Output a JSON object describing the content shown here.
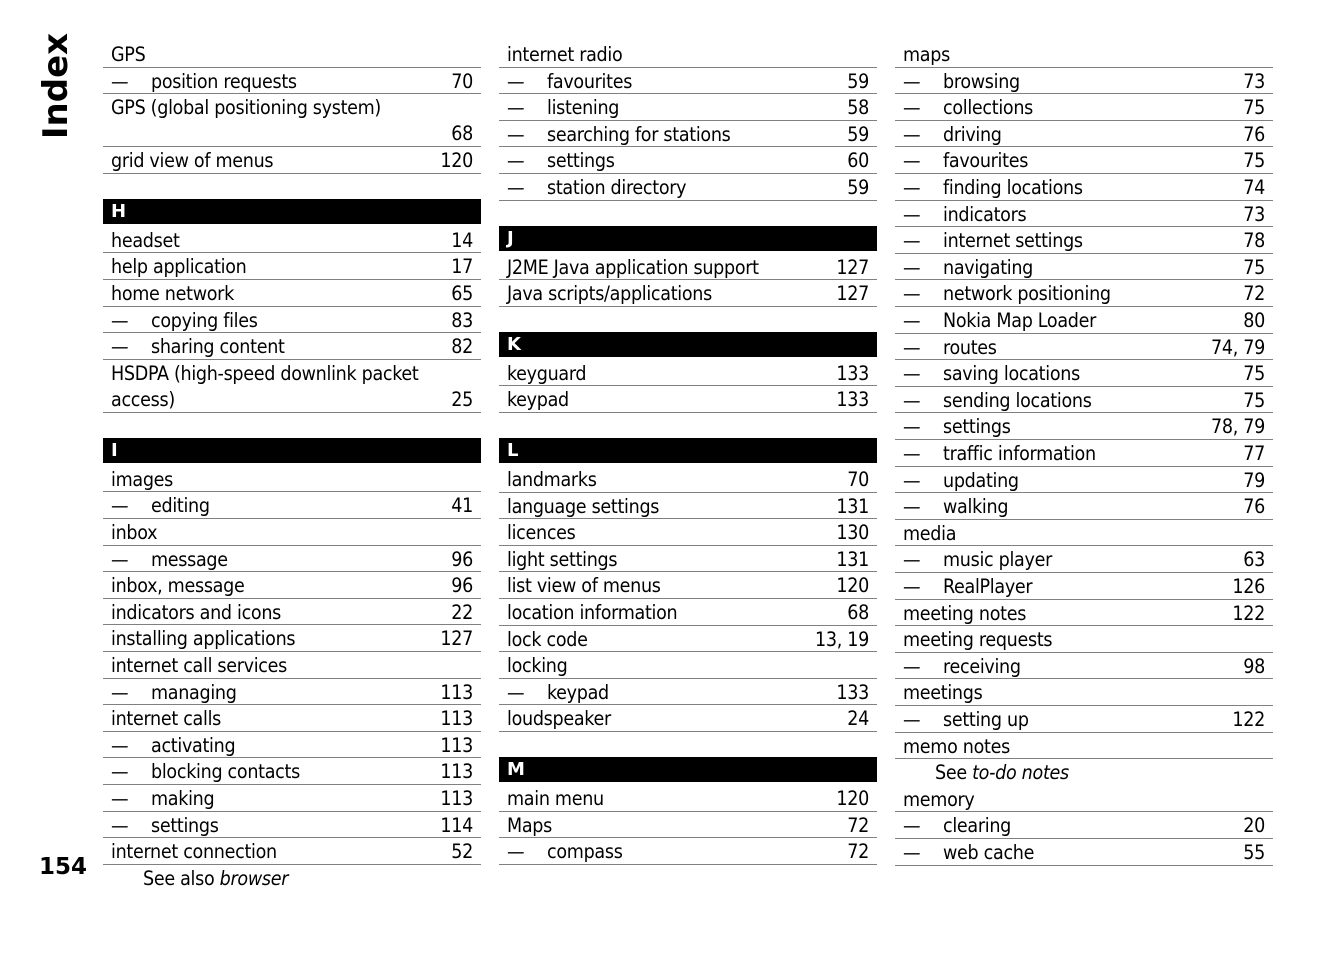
{
  "page": {
    "side_title": "Index",
    "page_number": "154"
  },
  "columns": [
    {
      "blocks": [
        {
          "type": "entry",
          "term": "GPS",
          "page": ""
        },
        {
          "type": "sub",
          "term": "position requests",
          "page": "70"
        },
        {
          "type": "tall",
          "term": "GPS (global positioning system)",
          "page": "68"
        },
        {
          "type": "entry",
          "term": "grid view of menus",
          "page": "120"
        },
        {
          "type": "header",
          "letter": "H"
        },
        {
          "type": "entry",
          "term": "headset",
          "page": "14"
        },
        {
          "type": "entry",
          "term": "help application",
          "page": "17"
        },
        {
          "type": "entry",
          "term": "home network",
          "page": "65"
        },
        {
          "type": "sub",
          "term": "copying files",
          "page": "83"
        },
        {
          "type": "sub",
          "term": "sharing content",
          "page": "82"
        },
        {
          "type": "tall",
          "term": "HSDPA (high-speed downlink packet access)",
          "page": "25"
        },
        {
          "type": "header",
          "letter": "I"
        },
        {
          "type": "entry",
          "term": "images",
          "page": ""
        },
        {
          "type": "sub",
          "term": "editing",
          "page": "41"
        },
        {
          "type": "entry",
          "term": "inbox",
          "page": ""
        },
        {
          "type": "sub",
          "term": "message",
          "page": "96"
        },
        {
          "type": "entry",
          "term": "inbox, message",
          "page": "96"
        },
        {
          "type": "entry",
          "term": "indicators and icons",
          "page": "22"
        },
        {
          "type": "entry",
          "term": "installing applications",
          "page": "127"
        },
        {
          "type": "entry",
          "term": "internet call services",
          "page": ""
        },
        {
          "type": "sub",
          "term": "managing",
          "page": "113"
        },
        {
          "type": "entry",
          "term": "internet calls",
          "page": "113"
        },
        {
          "type": "sub",
          "term": "activating",
          "page": "113"
        },
        {
          "type": "sub",
          "term": "blocking contacts",
          "page": "113"
        },
        {
          "type": "sub",
          "term": "making",
          "page": "113"
        },
        {
          "type": "sub",
          "term": "settings",
          "page": "114"
        },
        {
          "type": "entry",
          "term": "internet connection",
          "page": "52"
        },
        {
          "type": "see",
          "prefix": "See also",
          "target": "browser"
        }
      ]
    },
    {
      "blocks": [
        {
          "type": "entry",
          "term": "internet radio",
          "page": ""
        },
        {
          "type": "sub",
          "term": "favourites",
          "page": "59"
        },
        {
          "type": "sub",
          "term": "listening",
          "page": "58"
        },
        {
          "type": "sub",
          "term": "searching for stations",
          "page": "59"
        },
        {
          "type": "sub",
          "term": "settings",
          "page": "60"
        },
        {
          "type": "sub",
          "term": "station directory",
          "page": "59"
        },
        {
          "type": "header",
          "letter": "J"
        },
        {
          "type": "entry",
          "term": "J2ME Java application support",
          "page": "127"
        },
        {
          "type": "entry",
          "term": "Java scripts/applications",
          "page": "127"
        },
        {
          "type": "header",
          "letter": "K"
        },
        {
          "type": "entry",
          "term": "keyguard",
          "page": "133"
        },
        {
          "type": "entry",
          "term": "keypad",
          "page": "133"
        },
        {
          "type": "header",
          "letter": "L"
        },
        {
          "type": "entry",
          "term": "landmarks",
          "page": "70"
        },
        {
          "type": "entry",
          "term": "language settings",
          "page": "131"
        },
        {
          "type": "entry",
          "term": "licences",
          "page": "130"
        },
        {
          "type": "entry",
          "term": "light settings",
          "page": "131"
        },
        {
          "type": "entry",
          "term": "list view of menus",
          "page": "120"
        },
        {
          "type": "entry",
          "term": "location information",
          "page": "68"
        },
        {
          "type": "entry",
          "term": "lock code",
          "page": "13, 19"
        },
        {
          "type": "entry",
          "term": "locking",
          "page": ""
        },
        {
          "type": "sub",
          "term": "keypad",
          "page": "133"
        },
        {
          "type": "entry",
          "term": "loudspeaker",
          "page": "24"
        },
        {
          "type": "header",
          "letter": "M"
        },
        {
          "type": "entry",
          "term": "main menu",
          "page": "120"
        },
        {
          "type": "entry",
          "term": "Maps",
          "page": "72"
        },
        {
          "type": "sub",
          "term": "compass",
          "page": "72"
        }
      ]
    },
    {
      "blocks": [
        {
          "type": "entry",
          "term": "maps",
          "page": ""
        },
        {
          "type": "sub",
          "term": "browsing",
          "page": "73"
        },
        {
          "type": "sub",
          "term": "collections",
          "page": "75"
        },
        {
          "type": "sub",
          "term": "driving",
          "page": "76"
        },
        {
          "type": "sub",
          "term": "favourites",
          "page": "75"
        },
        {
          "type": "sub",
          "term": "finding locations",
          "page": "74"
        },
        {
          "type": "sub",
          "term": "indicators",
          "page": "73"
        },
        {
          "type": "sub",
          "term": "internet settings",
          "page": "78"
        },
        {
          "type": "sub",
          "term": "navigating",
          "page": "75"
        },
        {
          "type": "sub",
          "term": "network positioning",
          "page": "72"
        },
        {
          "type": "sub",
          "term": "Nokia Map Loader",
          "page": "80"
        },
        {
          "type": "sub",
          "term": "routes",
          "page": "74, 79"
        },
        {
          "type": "sub",
          "term": "saving locations",
          "page": "75"
        },
        {
          "type": "sub",
          "term": "sending locations",
          "page": "75"
        },
        {
          "type": "sub",
          "term": "settings",
          "page": "78, 79"
        },
        {
          "type": "sub",
          "term": "traffic information",
          "page": "77"
        },
        {
          "type": "sub",
          "term": "updating",
          "page": "79"
        },
        {
          "type": "sub",
          "term": "walking",
          "page": "76"
        },
        {
          "type": "entry",
          "term": "media",
          "page": ""
        },
        {
          "type": "sub",
          "term": "music player",
          "page": "63"
        },
        {
          "type": "sub",
          "term": "RealPlayer",
          "page": "126"
        },
        {
          "type": "entry",
          "term": "meeting notes",
          "page": "122"
        },
        {
          "type": "entry",
          "term": "meeting requests",
          "page": ""
        },
        {
          "type": "sub",
          "term": "receiving",
          "page": "98"
        },
        {
          "type": "entry",
          "term": "meetings",
          "page": ""
        },
        {
          "type": "sub",
          "term": "setting up",
          "page": "122"
        },
        {
          "type": "entry",
          "term": "memo notes",
          "page": ""
        },
        {
          "type": "see",
          "prefix": "See",
          "target": "to-do notes"
        },
        {
          "type": "entry",
          "term": "memory",
          "page": ""
        },
        {
          "type": "sub",
          "term": "clearing",
          "page": "20"
        },
        {
          "type": "sub",
          "term": "web cache",
          "page": "55"
        }
      ]
    }
  ],
  "dash_glyph": "—"
}
